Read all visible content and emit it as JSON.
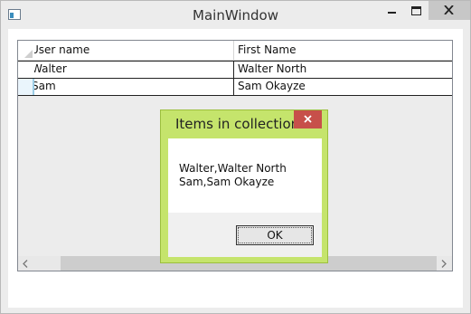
{
  "window": {
    "title": "MainWindow",
    "icon": "application-window-icon",
    "controls": [
      "minimize-icon",
      "maximize-icon",
      "close-icon"
    ]
  },
  "grid": {
    "columns": [
      "User name",
      "First Name"
    ],
    "rows": [
      {
        "user_name": "Walter",
        "first_name": "Walter North",
        "selected": false
      },
      {
        "user_name": "Sam",
        "first_name": "Sam Okayze",
        "selected": true
      }
    ],
    "horizontal_scrollbar": {
      "left_icon": "chevron-left-icon",
      "right_icon": "chevron-right-icon"
    }
  },
  "dialog": {
    "title": "Items in collection!",
    "message": "Walter,Walter North\nSam,Sam Okayze",
    "ok_label": "OK",
    "close_icon": "close-icon"
  },
  "colors": {
    "dialog_frame": "#c5e46c",
    "dialog_close": "#c7504a",
    "window_close": "#c7c7c7",
    "selected_row_header": "#eaf5fc"
  }
}
